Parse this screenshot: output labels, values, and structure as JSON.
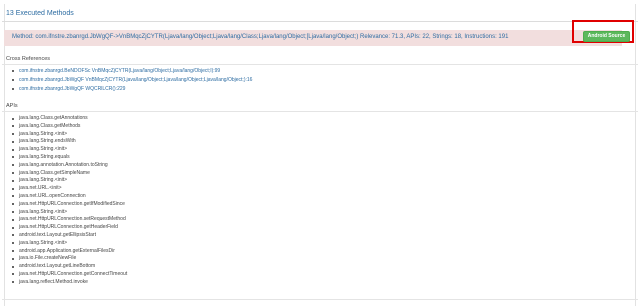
{
  "section": {
    "title": "13 Executed Methods"
  },
  "method": {
    "text": "Method: com.ifnstre.zbanrgd.JbWgQF->VnBMqcZjCYTR(Ljava/lang/Object;Ljava/lang/Class;Ljava/lang/Object;[Ljava/lang/Object;) Relevance: 71.3, APIs: 22, Strings: 18, Instructions: 191",
    "button_label": "Android Source",
    "bar_color": "#f2dede",
    "button_color": "#5cb85c",
    "highlight_color": "#e00000"
  },
  "cross_references": {
    "title": "Cross References",
    "items": [
      "com.ifnstre.zbanrgd.BeNDOFSc VnBMqcZjCYTR(Ljava/lang/Object;Ljava/lang/Object;I):99",
      "com.ifnstre.zbanrgd.JbWgQF VnBMqcZjCYTR(Ljava/lang/Object;Ljava/lang/Object;Ljava/lang/Object;):16",
      "com.ifnstre.zbanrgd.JbWgQF WQCRlLCR():229"
    ]
  },
  "apis": {
    "title": "APIs",
    "items": [
      "java.lang.Class.getAnnotations",
      "java.lang.Class.getMethods",
      "java.lang.String.<init>",
      "java.lang.String.endsWith",
      "java.lang.String.<init>",
      "java.lang.String.equals",
      "java.lang.annotation.Annotation.toString",
      "java.lang.Class.getSimpleName",
      "java.lang.String.<init>",
      "java.net.URL.<init>",
      "java.net.URL.openConnection",
      "java.net.HttpURLConnection.getIfModifiedSince",
      "java.lang.String.<init>",
      "java.net.HttpURLConnection.setRequestMethod",
      "java.net.HttpURLConnection.getHeaderField",
      "android.text.Layout.getEllipsisStart",
      "java.lang.String.<init>",
      "android.app.Application.getExternalFilesDir",
      "java.io.File.createNewFile",
      "android.text.Layout.getLineBottom",
      "java.net.HttpURLConnection.getConnectTimeout",
      "java.lang.reflect.Method.invoke"
    ]
  }
}
